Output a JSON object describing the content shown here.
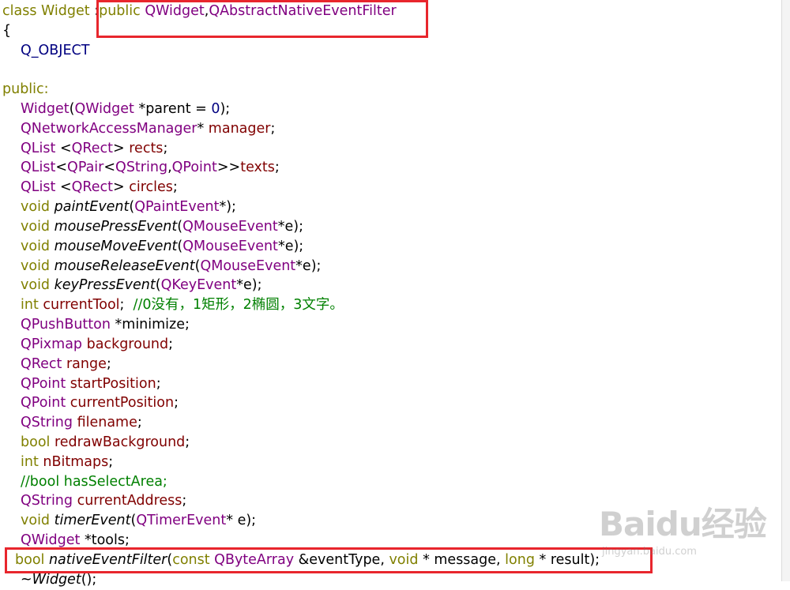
{
  "code": {
    "l1": {
      "a": "class Widget ",
      "b": ":",
      "c": "public ",
      "d": "QWidget",
      "e": ",",
      "f": "QAbstractNativeEventFilter"
    },
    "l2": "{",
    "l3": "Q_OBJECT",
    "l5": "public:",
    "l6": {
      "a": "Widget",
      "b": "(",
      "c": "QWidget",
      "d": " *parent = ",
      "e": "0",
      "f": ");"
    },
    "l7": {
      "a": "QNetworkAccessManager",
      "b": "* ",
      "c": "manager",
      "d": ";"
    },
    "l8": {
      "a": "QList ",
      "b": "<",
      "c": "QRect",
      "d": "> ",
      "e": "rects",
      "f": ";"
    },
    "l9": {
      "a": "QList",
      "b": "<",
      "c": "QPair",
      "d": "<",
      "e": "QString",
      "f": ",",
      "g": "QPoint",
      "h": ">>",
      "i": "texts",
      "j": ";"
    },
    "l10": {
      "a": "QList ",
      "b": "<",
      "c": "QRect",
      "d": "> ",
      "e": "circles",
      "f": ";"
    },
    "l11": {
      "a": "void ",
      "b": "paintEvent",
      "c": "(",
      "d": "QPaintEvent",
      "e": "*);"
    },
    "l12": {
      "a": "void ",
      "b": "mousePressEvent",
      "c": "(",
      "d": "QMouseEvent",
      "e": "*e);"
    },
    "l13": {
      "a": "void ",
      "b": "mouseMoveEvent",
      "c": "(",
      "d": "QMouseEvent",
      "e": "*e);"
    },
    "l14": {
      "a": "void ",
      "b": "mouseReleaseEvent",
      "c": "(",
      "d": "QMouseEvent",
      "e": "*e);"
    },
    "l15": {
      "a": "void ",
      "b": "keyPressEvent",
      "c": "(",
      "d": "QKeyEvent",
      "e": "*e);"
    },
    "l16": {
      "a": "int ",
      "b": "currentTool",
      "c": ";  ",
      "d": "//0没有，1矩形，2椭圆，3文字。"
    },
    "l17": {
      "a": "QPushButton",
      "b": " *minimize;"
    },
    "l18": {
      "a": "QPixmap ",
      "b": "background",
      "c": ";"
    },
    "l19": {
      "a": "QRect ",
      "b": "range",
      "c": ";"
    },
    "l20": {
      "a": "QPoint ",
      "b": "startPosition",
      "c": ";"
    },
    "l21": {
      "a": "QPoint ",
      "b": "currentPosition",
      "c": ";"
    },
    "l22": {
      "a": "QString ",
      "b": "filename",
      "c": ";"
    },
    "l23": {
      "a": "bool ",
      "b": "redrawBackground",
      "c": ";"
    },
    "l24": {
      "a": "int ",
      "b": "nBitmaps",
      "c": ";"
    },
    "l25": "//bool hasSelectArea;",
    "l26": {
      "a": "QString ",
      "b": "currentAddress",
      "c": ";"
    },
    "l27": {
      "a": "void ",
      "b": "timerEvent",
      "c": "(",
      "d": "QTimerEvent",
      "e": "* e);"
    },
    "l28": {
      "a": "QWidget",
      "b": " *tools;"
    },
    "l29": {
      "a": "bool ",
      "b": "nativeEventFilter",
      "c": "(",
      "d": "const ",
      "e": "QByteArray",
      "f": " &eventType, ",
      "g": "void",
      "h": " * message, ",
      "i": "long",
      "j": " * result);"
    },
    "l30": {
      "a": "~",
      "b": "Widget",
      "c": "();"
    }
  },
  "watermark": {
    "logo": "Baidu经验",
    "url": "jingyan.baidu.com"
  },
  "colors": {
    "keyword": "#808000",
    "class": "#800080",
    "member": "#800000",
    "comment": "#008000",
    "highlight_box": "#e8262d"
  }
}
